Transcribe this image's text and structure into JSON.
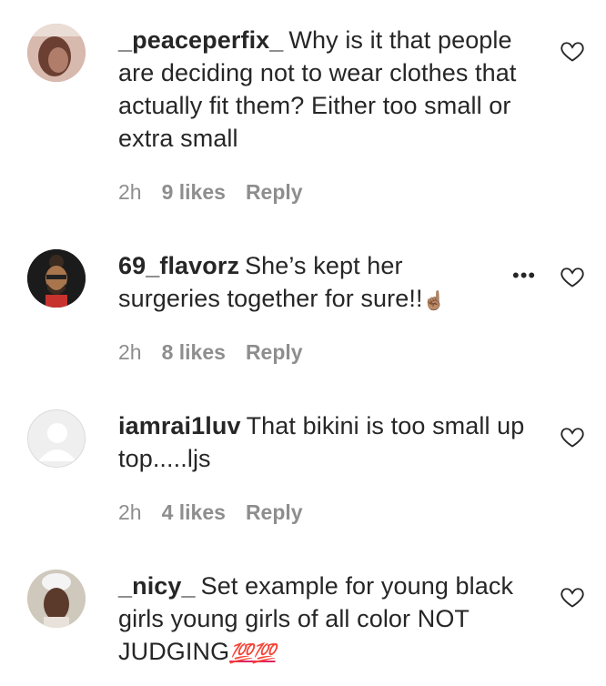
{
  "comments": [
    {
      "username": "_peaceperfix_",
      "text": "Why is it that people are deciding not to wear clothes that actually fit them? Either too small or extra small",
      "time": "2h",
      "likes": "9 likes",
      "reply": "Reply",
      "avatar_icon": "user-photo-avatar"
    },
    {
      "username": "69_flavorz",
      "text": "She’s kept her surgeries together for sure!!",
      "emoji": "☝🏽",
      "time": "2h",
      "likes": "8 likes",
      "reply": "Reply",
      "more": "•••",
      "avatar_icon": "illustrated-avatar"
    },
    {
      "username": "iamrai1luv",
      "text": "That bikini is too small up top.....ljs",
      "time": "2h",
      "likes": "4 likes",
      "reply": "Reply",
      "avatar_icon": "default-avatar"
    },
    {
      "username": "_nicy_",
      "text": "Set example for young black girls young girls of all color NOT JUDGING",
      "emoji": "💯💯",
      "avatar_icon": "user-photo-avatar"
    }
  ],
  "colors": {
    "text": "#262626",
    "meta": "#8e8e8e",
    "heart_stroke": "#262626"
  }
}
